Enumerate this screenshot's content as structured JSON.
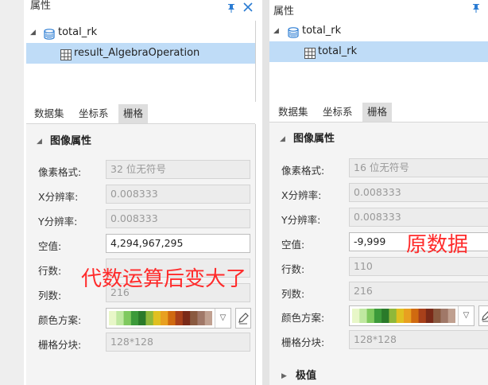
{
  "left": {
    "title": "属性",
    "tree": {
      "parent_label": "total_rk",
      "child_label": "result_AlgebraOperation"
    },
    "tabs": [
      "数据集",
      "坐标系",
      "栅格"
    ],
    "active_tab": "栅格",
    "section_title": "图像属性",
    "props": {
      "pixel_format": {
        "label": "像素格式:",
        "value": "32 位无符号"
      },
      "x_res": {
        "label": "X分辨率:",
        "value": "0.008333"
      },
      "y_res": {
        "label": "Y分辨率:",
        "value": "0.008333"
      },
      "nodata": {
        "label": "空值:",
        "value": "4,294,967,295"
      },
      "rows": {
        "label": "行数:",
        "value": ""
      },
      "cols": {
        "label": "列数:",
        "value": "216"
      },
      "color_scheme": {
        "label": "颜色方案:"
      },
      "block": {
        "label": "栅格分块:",
        "value": "128*128"
      }
    },
    "annotation": "代数运算后变大了"
  },
  "right": {
    "title": "属性",
    "tree": {
      "parent_label": "total_rk",
      "child_label": "total_rk"
    },
    "tabs": [
      "数据集",
      "坐标系",
      "栅格"
    ],
    "active_tab": "栅格",
    "section_title": "图像属性",
    "props": {
      "pixel_format": {
        "label": "像素格式:",
        "value": "16 位无符号"
      },
      "x_res": {
        "label": "X分辨率:",
        "value": "0.008333"
      },
      "y_res": {
        "label": "Y分辨率:",
        "value": "0.008333"
      },
      "nodata": {
        "label": "空值:",
        "value": "-9,999"
      },
      "rows": {
        "label": "行数:",
        "value": "110"
      },
      "cols": {
        "label": "列数:",
        "value": "216"
      },
      "color_scheme": {
        "label": "颜色方案:"
      },
      "block": {
        "label": "栅格分块:",
        "value": "128*128"
      }
    },
    "section2_title": "极值",
    "annotation": "原数据"
  },
  "colors": {
    "accent": "#2b7cd3",
    "selection": "#bfdcf7",
    "annotation": "#ff2b2b",
    "ramp": [
      "#e8f7c8",
      "#bfe8a0",
      "#7fc95e",
      "#3c9a3a",
      "#2a7a2a",
      "#8fb83a",
      "#e0c020",
      "#e8a020",
      "#d06a10",
      "#a8401a",
      "#7a2a18",
      "#8a5a40",
      "#a07868",
      "#c0a090"
    ]
  },
  "icons": [
    "pin-icon",
    "close-icon",
    "database-icon",
    "grid-icon",
    "chevron-down-icon",
    "pencil-icon",
    "collapse-icon",
    "expand-icon"
  ]
}
